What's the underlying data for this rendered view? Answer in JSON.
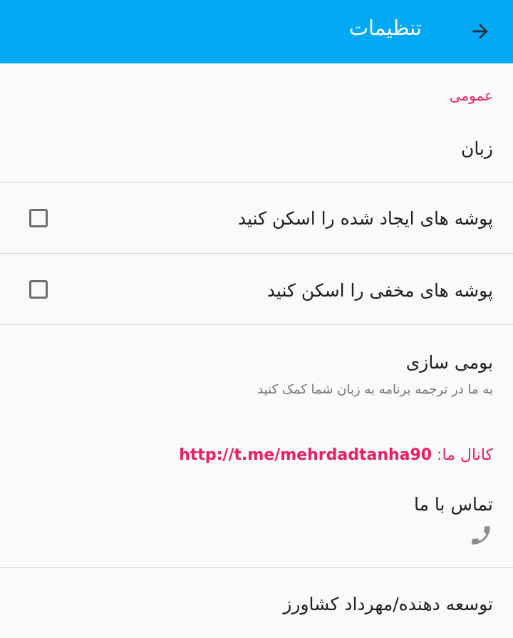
{
  "appbar": {
    "title": "تنظیمات",
    "back_icon": "arrow-forward-icon"
  },
  "general": {
    "header": "عمومی",
    "language_title": "زبان"
  },
  "prefs": {
    "scan_created_folders": {
      "title": "پوشه های ایجاد شده را اسکن کنید",
      "checked": false
    },
    "scan_hidden_folders": {
      "title": "پوشه های مخفی را اسکن کنید",
      "checked": false
    },
    "localization": {
      "title": "بومی سازی",
      "summary": "به ما در ترجمه برنامه به زبان شما کمک کنید"
    },
    "channel": {
      "label": "کانال ما:",
      "link": "http://t.me/mehrdadtanha90"
    },
    "contact": {
      "title": "تماس با ما",
      "icon": "phone-icon"
    },
    "developer": {
      "title": "توسعه دهنده/مهرداد کشاورز"
    }
  },
  "colors": {
    "appbar": "#03a9f4",
    "accent": "#e91e63"
  }
}
